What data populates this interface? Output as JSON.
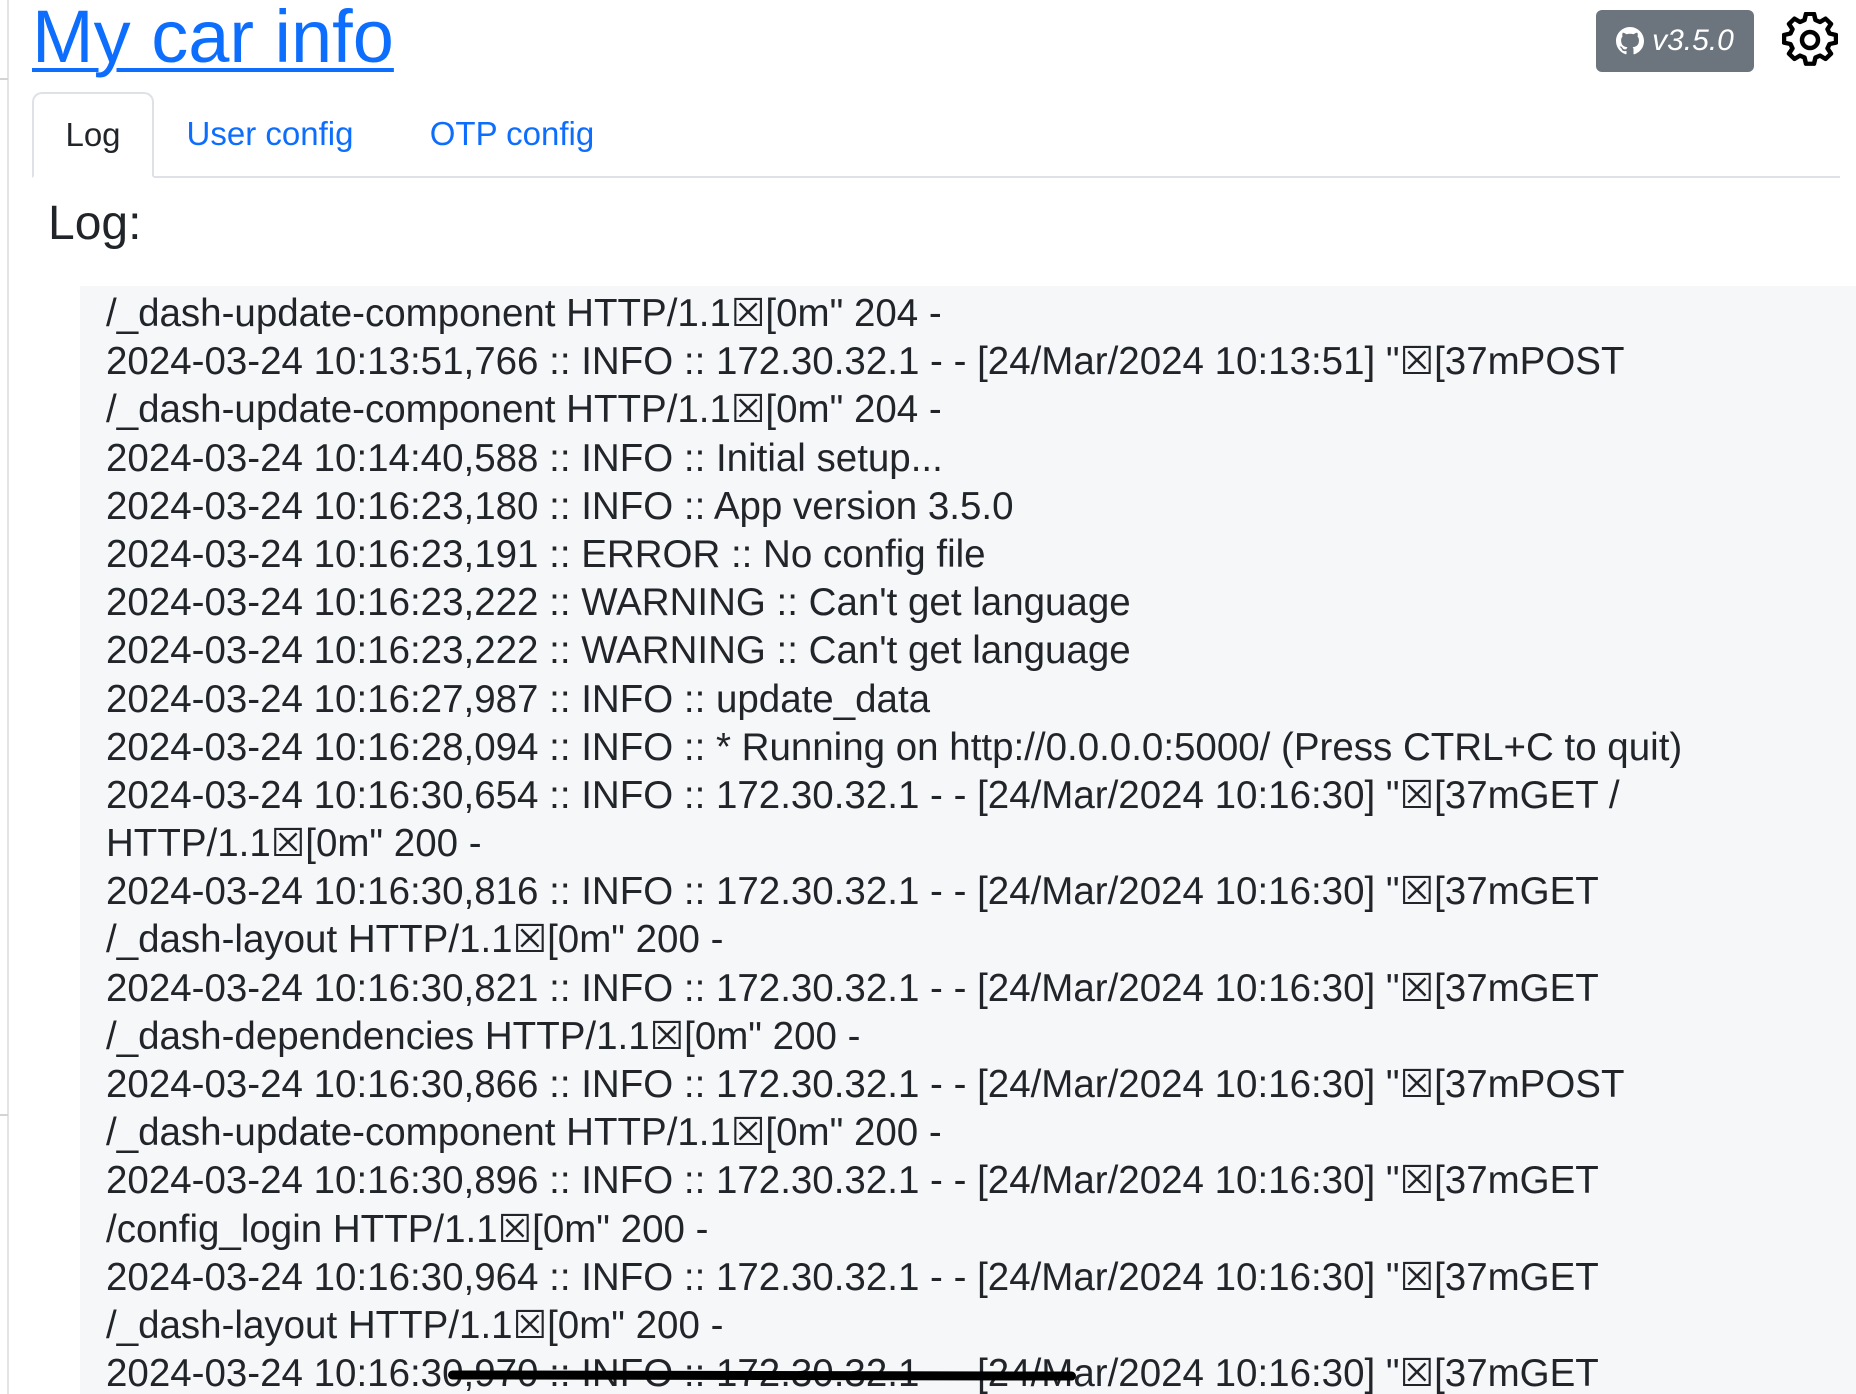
{
  "app": {
    "title": "My car info",
    "version_label": "v3.5.0",
    "github_icon": "github-icon",
    "settings_icon": "gear-icon"
  },
  "tabs": [
    {
      "label": "Log",
      "active": true
    },
    {
      "label": "User config",
      "active": false
    },
    {
      "label": "OTP config",
      "active": false
    }
  ],
  "log": {
    "heading": "Log:",
    "lines": [
      "/_dash-update-component HTTP/1.1☒[0m\" 204 -",
      "2024-03-24 10:13:51,766 :: INFO :: 172.30.32.1 - - [24/Mar/2024 10:13:51] \"☒[37mPOST",
      "/_dash-update-component HTTP/1.1☒[0m\" 204 -",
      "2024-03-24 10:14:40,588 :: INFO :: Initial setup...",
      "2024-03-24 10:16:23,180 :: INFO :: App version 3.5.0",
      "2024-03-24 10:16:23,191 :: ERROR :: No config file",
      "2024-03-24 10:16:23,222 :: WARNING :: Can't get language",
      "2024-03-24 10:16:23,222 :: WARNING :: Can't get language",
      "2024-03-24 10:16:27,987 :: INFO :: update_data",
      "2024-03-24 10:16:28,094 :: INFO :: * Running on http://0.0.0.0:5000/ (Press CTRL+C to quit)",
      "2024-03-24 10:16:30,654 :: INFO :: 172.30.32.1 - - [24/Mar/2024 10:16:30] \"☒[37mGET /",
      "HTTP/1.1☒[0m\" 200 -",
      "2024-03-24 10:16:30,816 :: INFO :: 172.30.32.1 - - [24/Mar/2024 10:16:30] \"☒[37mGET",
      "/_dash-layout HTTP/1.1☒[0m\" 200 -",
      "2024-03-24 10:16:30,821 :: INFO :: 172.30.32.1 - - [24/Mar/2024 10:16:30] \"☒[37mGET",
      "/_dash-dependencies HTTP/1.1☒[0m\" 200 -",
      "2024-03-24 10:16:30,866 :: INFO :: 172.30.32.1 - - [24/Mar/2024 10:16:30] \"☒[37mPOST",
      "/_dash-update-component HTTP/1.1☒[0m\" 200 -",
      "2024-03-24 10:16:30,896 :: INFO :: 172.30.32.1 - - [24/Mar/2024 10:16:30] \"☒[37mGET",
      "/config_login HTTP/1.1☒[0m\" 200 -",
      "2024-03-24 10:16:30,964 :: INFO :: 172.30.32.1 - - [24/Mar/2024 10:16:30] \"☒[37mGET",
      "/_dash-layout HTTP/1.1☒[0m\" 200 -",
      "2024-03-24 10:16:30,970 :: INFO :: 172.30.32.1 - - [24/Mar/2024 10:16:30] \"☒[37mGET"
    ]
  }
}
